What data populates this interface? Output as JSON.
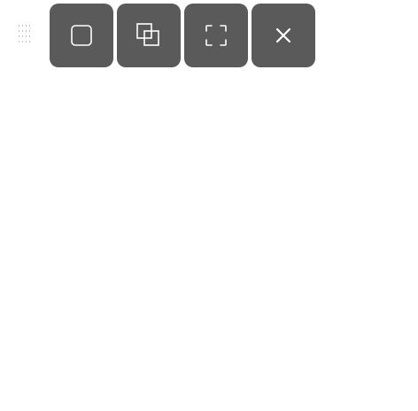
{
  "toolbar": {
    "drag_handle_icon": "drag-handle-icon",
    "buttons": [
      {
        "id": "window-mode",
        "icon": "window-icon"
      },
      {
        "id": "restore-mode",
        "icon": "restore-icon"
      },
      {
        "id": "fullscreen-mode",
        "icon": "fullscreen-icon"
      },
      {
        "id": "close",
        "icon": "close-icon"
      }
    ],
    "colors": {
      "button_bg": "#5a5a5a",
      "icon_stroke": "#ffffff",
      "handle_dots": "#b8c4c8"
    }
  }
}
